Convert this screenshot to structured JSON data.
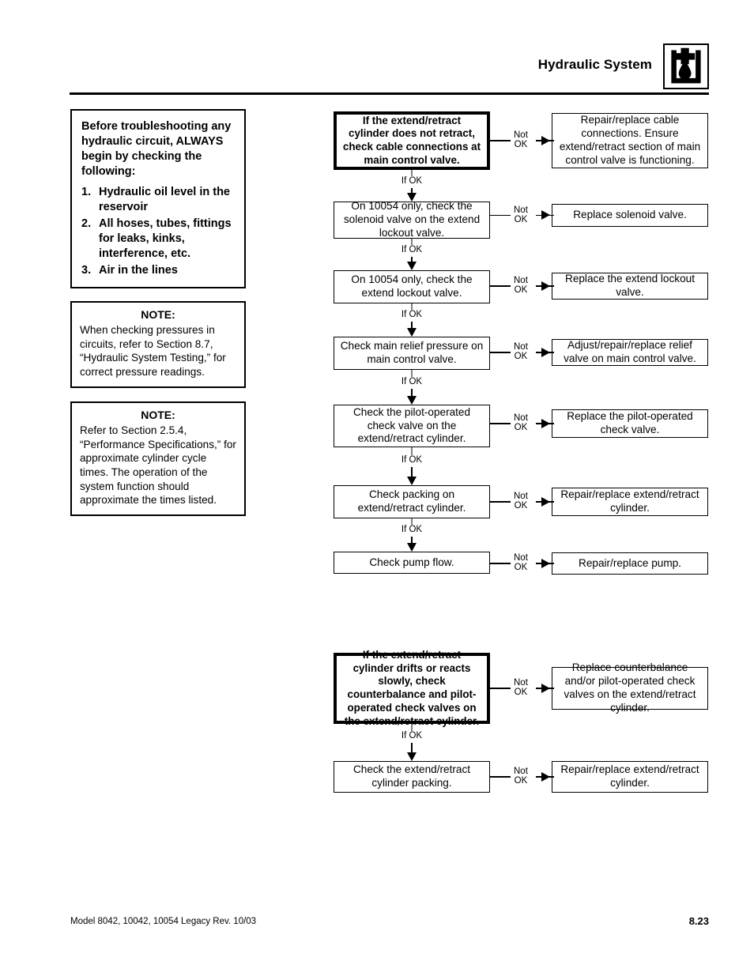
{
  "header": {
    "title": "Hydraulic System",
    "icon": "hydraulic-fluid-drop-icon"
  },
  "left_column": {
    "warning": {
      "heading": "Before troubleshooting any hydraulic circuit, ALWAYS begin by checking the following:",
      "items": [
        {
          "num": "1.",
          "text": "Hydraulic oil level in the reservoir"
        },
        {
          "num": "2.",
          "text": "All hoses, tubes, fittings for leaks, kinks, interference, etc."
        },
        {
          "num": "3.",
          "text": "Air in the lines"
        }
      ]
    },
    "notes": [
      {
        "title": "NOTE:",
        "body": "When checking pressures in circuits, refer to Section 8.7, “Hydraulic System Testing,” for correct pressure readings."
      },
      {
        "title": "NOTE:",
        "body": "Refer to Section 2.5.4, “Performance Specifications,” for approximate cylinder cycle times. The operation of the system function should approximate the times listed."
      }
    ]
  },
  "flowcharts": [
    {
      "id": "no-retract-flow",
      "branch_label": "Not OK",
      "link_label": "If OK",
      "rows": [
        {
          "check": "If the extend/retract cylinder does not retract, check cable connections at main control valve.",
          "bold": true,
          "action": "Repair/replace cable connections. Ensure extend/retract section of main control valve is functioning."
        },
        {
          "check": "On 10054 only, check the solenoid valve on the extend lockout valve.",
          "bold": false,
          "action": "Replace solenoid valve."
        },
        {
          "check": "On 10054 only, check the extend lockout valve.",
          "bold": false,
          "action": "Replace the extend lockout valve."
        },
        {
          "check": "Check main relief pressure on main control valve.",
          "bold": false,
          "action": "Adjust/repair/replace relief valve on main control valve."
        },
        {
          "check": "Check the pilot-operated check valve on the extend/retract cylinder.",
          "bold": false,
          "action": "Replace the pilot-operated check valve."
        },
        {
          "check": "Check packing on extend/retract cylinder.",
          "bold": false,
          "action": "Repair/replace extend/retract cylinder."
        },
        {
          "check": "Check pump flow.",
          "bold": false,
          "action": "Repair/replace pump."
        }
      ]
    },
    {
      "id": "drift-slow-flow",
      "branch_label": "Not OK",
      "link_label": "If OK",
      "rows": [
        {
          "check": "If the extend/retract cylinder drifts or reacts slowly, check counterbalance and pilot-operated check valves on the extend/retract cylinder.",
          "bold": true,
          "action": "Replace counterbalance and/or pilot-operated check valves on the extend/retract cylinder."
        },
        {
          "check": "Check the extend/retract cylinder packing.",
          "bold": false,
          "action": "Repair/replace extend/retract cylinder."
        }
      ]
    }
  ],
  "footer": {
    "models": "Model  8042, 10042, 10054 Legacy    Rev.  10/03",
    "page": "8.23"
  }
}
